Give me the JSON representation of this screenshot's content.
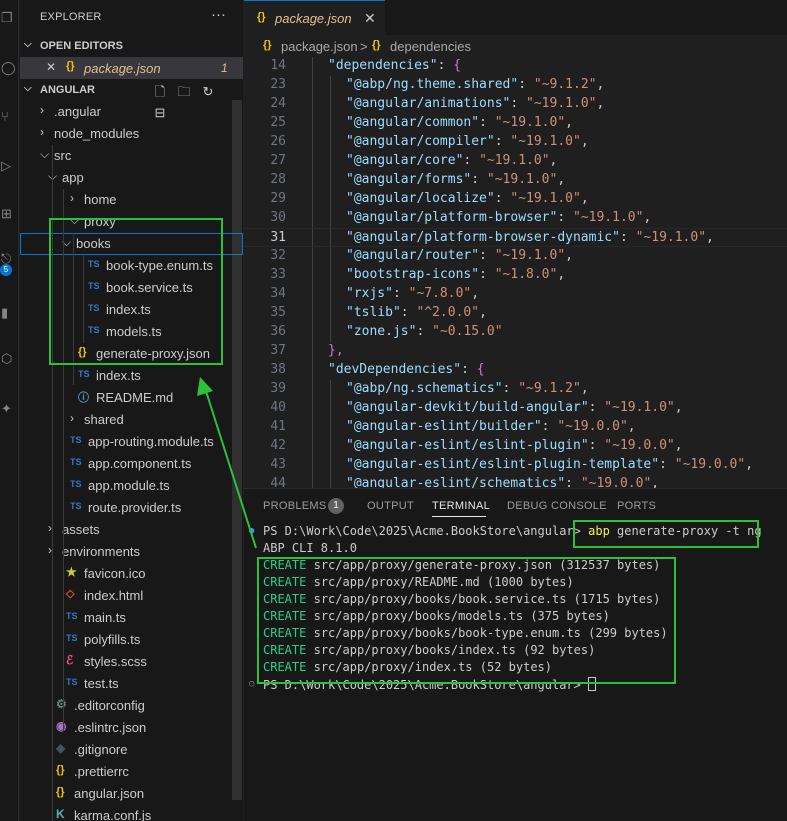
{
  "activity_bar": {
    "icons": [
      "explorer-icon",
      "search-icon",
      "source-control-icon",
      "run-debug-icon",
      "extensions-icon",
      "remote-icon",
      "testing-icon",
      "docker-icon",
      "settings-icon"
    ],
    "badge": "5"
  },
  "sidebar": {
    "title": "EXPLORER",
    "more": "···",
    "open_editors_label": "OPEN EDITORS",
    "open_editor": {
      "close": "✕",
      "icon": "{}",
      "name": "package.json",
      "count": "1"
    },
    "project_label": "ANGULAR",
    "tree": [
      {
        "name": ".angular",
        "type": "folder",
        "expanded": false
      },
      {
        "name": "node_modules",
        "type": "folder",
        "expanded": false
      },
      {
        "name": "src",
        "type": "folder",
        "expanded": true
      },
      {
        "name": "app",
        "type": "folder",
        "expanded": true
      },
      {
        "name": "home",
        "type": "folder",
        "expanded": false
      },
      {
        "name": "proxy",
        "type": "folder",
        "expanded": true
      },
      {
        "name": "books",
        "type": "folder",
        "expanded": true
      },
      {
        "name": "book-type.enum.ts",
        "type": "ts"
      },
      {
        "name": "book.service.ts",
        "type": "ts"
      },
      {
        "name": "index.ts",
        "type": "ts"
      },
      {
        "name": "models.ts",
        "type": "ts"
      },
      {
        "name": "generate-proxy.json",
        "type": "json"
      },
      {
        "name": "index.ts",
        "type": "ts"
      },
      {
        "name": "README.md",
        "type": "md"
      },
      {
        "name": "shared",
        "type": "folder",
        "expanded": false
      },
      {
        "name": "app-routing.module.ts",
        "type": "ts"
      },
      {
        "name": "app.component.ts",
        "type": "ts"
      },
      {
        "name": "app.module.ts",
        "type": "ts"
      },
      {
        "name": "route.provider.ts",
        "type": "ts"
      },
      {
        "name": "assets",
        "type": "folder",
        "expanded": false
      },
      {
        "name": "environments",
        "type": "folder",
        "expanded": false
      },
      {
        "name": "favicon.ico",
        "type": "star"
      },
      {
        "name": "index.html",
        "type": "html"
      },
      {
        "name": "main.ts",
        "type": "ts"
      },
      {
        "name": "polyfills.ts",
        "type": "ts"
      },
      {
        "name": "styles.scss",
        "type": "scss"
      },
      {
        "name": "test.ts",
        "type": "ts"
      },
      {
        "name": ".editorconfig",
        "type": "gear"
      },
      {
        "name": ".eslintrc.json",
        "type": "eslint"
      },
      {
        "name": ".gitignore",
        "type": "git"
      },
      {
        "name": ".prettierrc",
        "type": "json"
      },
      {
        "name": "angular.json",
        "type": "json"
      },
      {
        "name": "karma.conf.js",
        "type": "karma"
      }
    ]
  },
  "editor": {
    "tab": {
      "icon": "{}",
      "label": "package.json",
      "close": "✕"
    },
    "breadcrumb": [
      "package.json",
      "dependencies"
    ],
    "breadcrumb_sep": ">",
    "lines": [
      {
        "n": "14",
        "key": "dependencies",
        "value": "",
        "end": "{",
        "open": true
      },
      {
        "n": "23",
        "key": "@abp/ng.theme.shared",
        "value": "~9.1.2",
        "end": ","
      },
      {
        "n": "24",
        "key": "@angular/animations",
        "value": "~19.1.0",
        "end": ","
      },
      {
        "n": "25",
        "key": "@angular/common",
        "value": "~19.1.0",
        "end": ","
      },
      {
        "n": "26",
        "key": "@angular/compiler",
        "value": "~19.1.0",
        "end": ","
      },
      {
        "n": "27",
        "key": "@angular/core",
        "value": "~19.1.0",
        "end": ","
      },
      {
        "n": "28",
        "key": "@angular/forms",
        "value": "~19.1.0",
        "end": ","
      },
      {
        "n": "29",
        "key": "@angular/localize",
        "value": "~19.1.0",
        "end": ","
      },
      {
        "n": "30",
        "key": "@angular/platform-browser",
        "value": "~19.1.0",
        "end": ","
      },
      {
        "n": "31",
        "key": "@angular/platform-browser-dynamic",
        "value": "~19.1.0",
        "end": ",",
        "current": true
      },
      {
        "n": "32",
        "key": "@angular/router",
        "value": "~19.1.0",
        "end": ","
      },
      {
        "n": "33",
        "key": "bootstrap-icons",
        "value": "~1.8.0",
        "end": ","
      },
      {
        "n": "34",
        "key": "rxjs",
        "value": "~7.8.0",
        "end": ","
      },
      {
        "n": "35",
        "key": "tslib",
        "value": "^2.0.0",
        "end": ","
      },
      {
        "n": "36",
        "key": "zone.js",
        "value": "~0.15.0",
        "end": ""
      },
      {
        "n": "37",
        "key": "",
        "value": "",
        "end": "},",
        "close": true
      },
      {
        "n": "38",
        "key": "devDependencies",
        "value": "",
        "end": "{",
        "open": true
      },
      {
        "n": "39",
        "key": "@abp/ng.schematics",
        "value": "~9.1.2",
        "end": ","
      },
      {
        "n": "40",
        "key": "@angular-devkit/build-angular",
        "value": "~19.1.0",
        "end": ","
      },
      {
        "n": "41",
        "key": "@angular-eslint/builder",
        "value": "~19.0.0",
        "end": ","
      },
      {
        "n": "42",
        "key": "@angular-eslint/eslint-plugin",
        "value": "~19.0.0",
        "end": ","
      },
      {
        "n": "43",
        "key": "@angular-eslint/eslint-plugin-template",
        "value": "~19.0.0",
        "end": ","
      },
      {
        "n": "44",
        "key": "@angular-eslint/schematics",
        "value": "~19.0.0",
        "end": ","
      }
    ]
  },
  "panel": {
    "tabs": [
      "PROBLEMS",
      "OUTPUT",
      "TERMINAL",
      "DEBUG CONSOLE",
      "PORTS"
    ],
    "active_tab": "TERMINAL",
    "problems_count": "1",
    "prompt": "PS D:\\Work\\Code\\2025\\Acme.BookStore\\angular>",
    "command": {
      "bin": "abp",
      "args": "generate-proxy -t ng"
    },
    "cli_version": "ABP CLI 8.1.0",
    "create_word": "CREATE",
    "created_files": [
      "src/app/proxy/generate-proxy.json (312537 bytes)",
      "src/app/proxy/README.md (1000 bytes)",
      "src/app/proxy/books/book.service.ts (1715 bytes)",
      "src/app/proxy/books/models.ts (375 bytes)",
      "src/app/proxy/books/book-type.enum.ts (299 bytes)",
      "src/app/proxy/books/index.ts (92 bytes)",
      "src/app/proxy/index.ts (52 bytes)"
    ]
  },
  "colors": {
    "highlight_box": "#2bc236",
    "accent": "#0078d4",
    "terminal_green": "#23d18b",
    "terminal_yellow": "#f5f543"
  }
}
